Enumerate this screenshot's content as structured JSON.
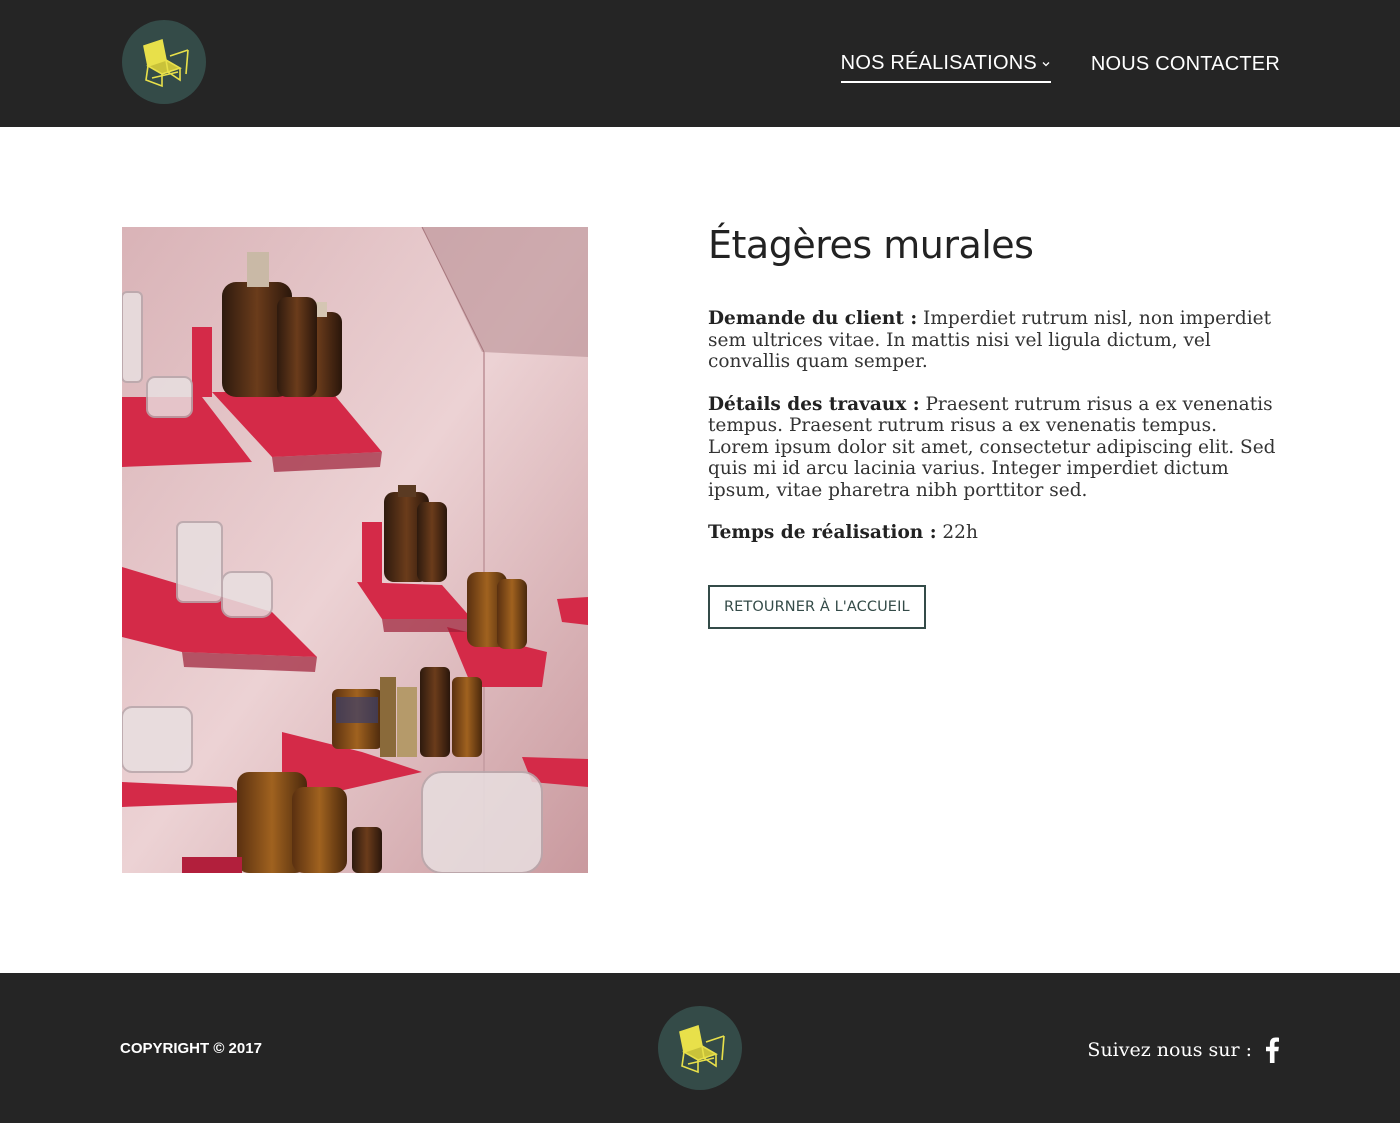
{
  "header": {
    "nav": [
      {
        "label": "NOS RÉALISATIONS",
        "active": true,
        "has_dropdown": true
      },
      {
        "label": "NOUS CONTACTER",
        "active": false,
        "has_dropdown": false
      }
    ]
  },
  "main": {
    "title": "Étagères murales",
    "paragraphs": [
      {
        "label": "Demande du client :",
        "text": " Imperdiet rutrum nisl, non imperdiet sem ultrices vitae. In mattis nisi vel ligula dictum, vel convallis quam semper."
      },
      {
        "label": "Détails des travaux :",
        "text": " Praesent rutrum risus a ex venenatis tempus. Praesent rutrum risus a ex venenatis tempus. Lorem ipsum dolor sit amet, consectetur adipiscing elit. Sed quis mi id arcu lacinia varius. Integer imperdiet dictum ipsum, vitae pharetra nibh porttitor sed."
      },
      {
        "label": "Temps de réalisation :",
        "text": " 22h"
      }
    ],
    "back_button": "RETOURNER À L'ACCUEIL"
  },
  "footer": {
    "copyright": "COPYRIGHT © 2017",
    "follow_label": "Suivez nous sur :",
    "social_icon": "facebook-icon"
  },
  "colors": {
    "header_bg": "#252525",
    "logo_bg": "#344b48",
    "logo_accent": "#e8e04a",
    "accent": "#344b48",
    "shelf_red": "#d42a48"
  }
}
